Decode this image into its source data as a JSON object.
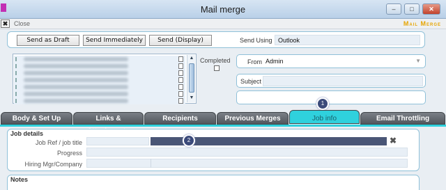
{
  "window": {
    "title": "Mail merge",
    "minimize": "–",
    "maximize": "□",
    "close": "✕"
  },
  "closebar": {
    "label": "Close",
    "brand": "Mail Merge"
  },
  "toolbar": {
    "send_as_draft": "Send as Draft",
    "send_immediately": "Send Immediately",
    "send_display": "Send (Display)",
    "send_using_label": "Send Using",
    "send_using_value": "Outlook"
  },
  "recipients_list": {
    "row_count": 7
  },
  "completed_label": "Completed",
  "from": {
    "label": "From",
    "value": "Admin"
  },
  "subject": {
    "label": "Subject",
    "value": ""
  },
  "tabs": [
    {
      "label": "Body & Set Up"
    },
    {
      "label": "Links & Attachments"
    },
    {
      "label": "Recipients"
    },
    {
      "label": "Previous Merges"
    },
    {
      "label": "Job info",
      "active": true
    },
    {
      "label": "Email Throttling"
    }
  ],
  "badges": {
    "first": "1",
    "second": "2"
  },
  "job_details": {
    "title": "Job details",
    "job_ref_label": "Job Ref / job title",
    "progress_label": "Progress",
    "hiring_label": "Hiring Mgr/Company"
  },
  "notes": {
    "title": "Notes"
  }
}
